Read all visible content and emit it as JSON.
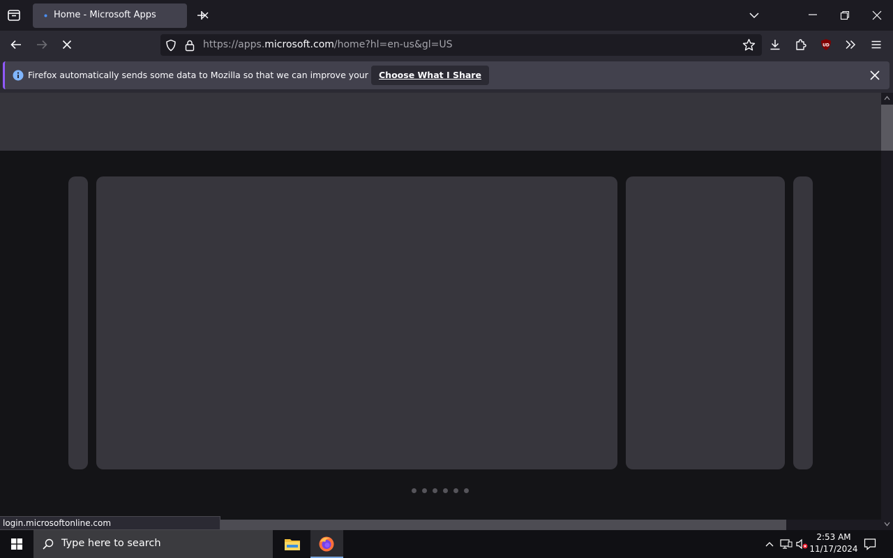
{
  "browser": {
    "tab": {
      "title": "Home - Microsoft Apps"
    },
    "url": {
      "prefix": "https://apps.",
      "domain": "microsoft.com",
      "suffix": "/home?hl=en-us&gl=US"
    },
    "notification": {
      "message": "Firefox automatically sends some data to Mozilla so that we can improve your experience.",
      "button": "Choose What I Share"
    },
    "status_link": "login.microsoftonline.com"
  },
  "icons": {
    "firefox_view": "firefox-view-icon",
    "new_tab": "plus-icon",
    "list_all_tabs": "chevron-down-icon",
    "back": "arrow-left-icon",
    "forward": "arrow-right-icon",
    "stop": "close-icon",
    "tracking_protection": "shield-icon",
    "secure": "lock-icon",
    "bookmark": "star-icon",
    "downloads": "download-icon",
    "extensions": "puzzle-icon",
    "ublock": "ublock-icon",
    "overflow": "double-chevron-icon",
    "menu": "hamburger-icon",
    "info": "info-icon"
  },
  "content": {
    "carousel_dot_count": 6
  },
  "taskbar": {
    "search_placeholder": "Type here to search",
    "time": "2:53 AM",
    "date": "11/17/2024"
  },
  "colors": {
    "accent": "#9059ff",
    "info_blue": "#80ebff",
    "ublock_red": "#800000"
  }
}
